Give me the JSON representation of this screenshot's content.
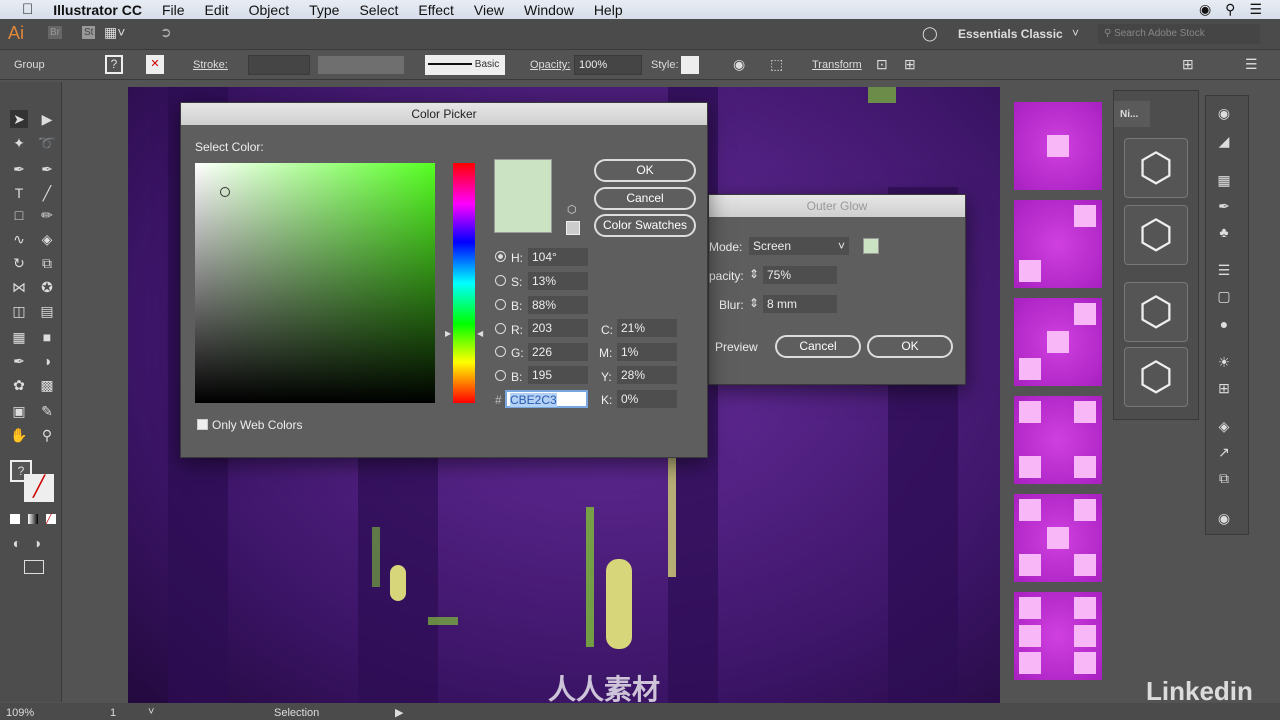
{
  "menubar": {
    "app": "Illustrator CC",
    "items": [
      "File",
      "Edit",
      "Object",
      "Type",
      "Select",
      "Effect",
      "View",
      "Window",
      "Help"
    ]
  },
  "appbar": {
    "logo": "Ai",
    "br": "Br",
    "st": "St",
    "workspace": "Essentials Classic",
    "search_placeholder": "Search Adobe Stock"
  },
  "control": {
    "selection": "Group",
    "fill": "?",
    "stroke_label": "Stroke:",
    "brush": "Basic",
    "opacity_label": "Opacity:",
    "opacity": "100%",
    "style_label": "Style:",
    "transform": "Transform"
  },
  "color_picker": {
    "title": "Color Picker",
    "select_color": "Select Color:",
    "ok": "OK",
    "cancel": "Cancel",
    "swatches": "Color Swatches",
    "only_web": "Only Web Colors",
    "fields": {
      "H": "104°",
      "S": "13%",
      "B": "88%",
      "R": "203",
      "G": "226",
      "B2": "195",
      "C": "21%",
      "M": "1%",
      "Y": "28%",
      "K": "0%",
      "hex": "CBE2C3"
    },
    "labels": {
      "H": "H:",
      "S": "S:",
      "B": "B:",
      "R": "R:",
      "G": "G:",
      "B2": "B:",
      "C": "C:",
      "M": "M:",
      "Y": "Y:",
      "K": "K:",
      "hash": "#"
    },
    "new_color": "#CBE2C3",
    "hue_color": "#55ff22"
  },
  "outer_glow": {
    "title": "Outer Glow",
    "mode_label": "Mode:",
    "mode": "Screen",
    "opacity_label": "pacity:",
    "opacity": "75%",
    "blur_label": "Blur:",
    "blur": "8 mm",
    "preview": "Preview",
    "cancel": "Cancel",
    "ok": "OK"
  },
  "panel": {
    "tab": "Ni..."
  },
  "status": {
    "zoom": "109%",
    "artboard": "1",
    "tool": "Selection"
  },
  "watermark": {
    "brand": "人人素材",
    "linkedin": "Linkedin"
  }
}
